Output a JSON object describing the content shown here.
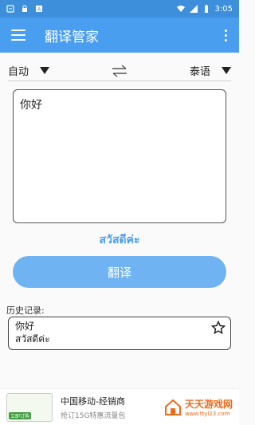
{
  "status_bar": {
    "time": "3:05"
  },
  "app_bar": {
    "title": "翻译管家"
  },
  "lang_bar": {
    "source_lang": "自动",
    "target_lang": "泰语"
  },
  "source": {
    "text": "你好"
  },
  "result": {
    "text": "สวัสดีค่ะ"
  },
  "translate_button": {
    "label": "翻译"
  },
  "history": {
    "label": "历史记录:",
    "items": [
      {
        "source": "你好",
        "translation": "สวัสดีค่ะ"
      }
    ]
  },
  "ad": {
    "title": "中国移动-经销商",
    "subtitle": "抢订15G特惠流量包",
    "thumb_badge": "立即订购",
    "site_name": "天天游戏网",
    "site_url": "www.ttyl23.com"
  },
  "colors": {
    "status": "#3d8fdc",
    "appbar": "#4a9ef0",
    "accent": "#4a9ef0",
    "button": "#6fb3f2"
  }
}
